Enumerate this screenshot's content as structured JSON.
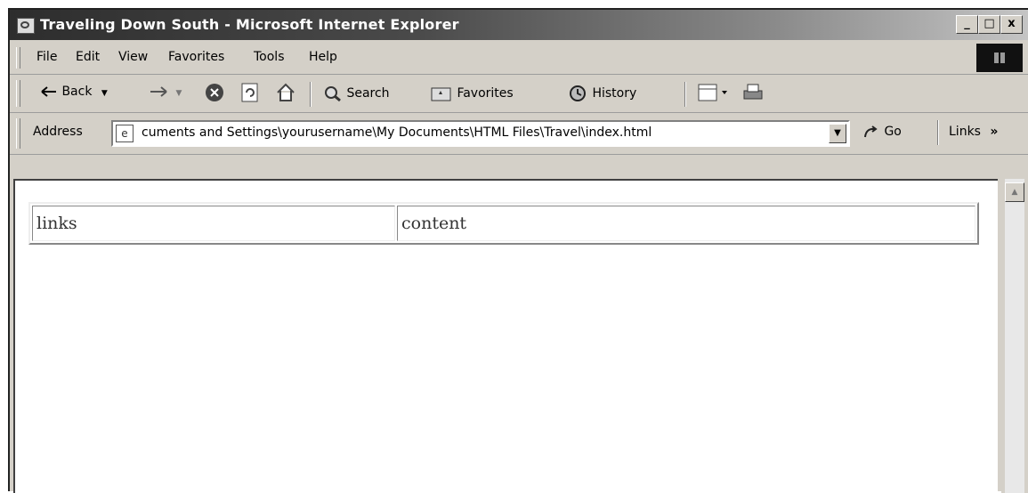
{
  "window": {
    "title": "Traveling Down South - Microsoft Internet Explorer",
    "caption_buttons": [
      "_",
      "□",
      "x"
    ]
  },
  "menu": {
    "items": [
      "File",
      "Edit",
      "View",
      "Favorites",
      "Tools",
      "Help"
    ]
  },
  "toolbar": {
    "back_label": "Back",
    "search_label": "Search",
    "favorites_label": "Favorites",
    "history_label": "History"
  },
  "address_bar": {
    "label": "Address",
    "url": "cuments and Settings\\yourusername\\My Documents\\HTML Files\\Travel\\index.html",
    "go_label": "Go",
    "links_label": "Links"
  },
  "page": {
    "cells": [
      "links",
      "content"
    ]
  }
}
